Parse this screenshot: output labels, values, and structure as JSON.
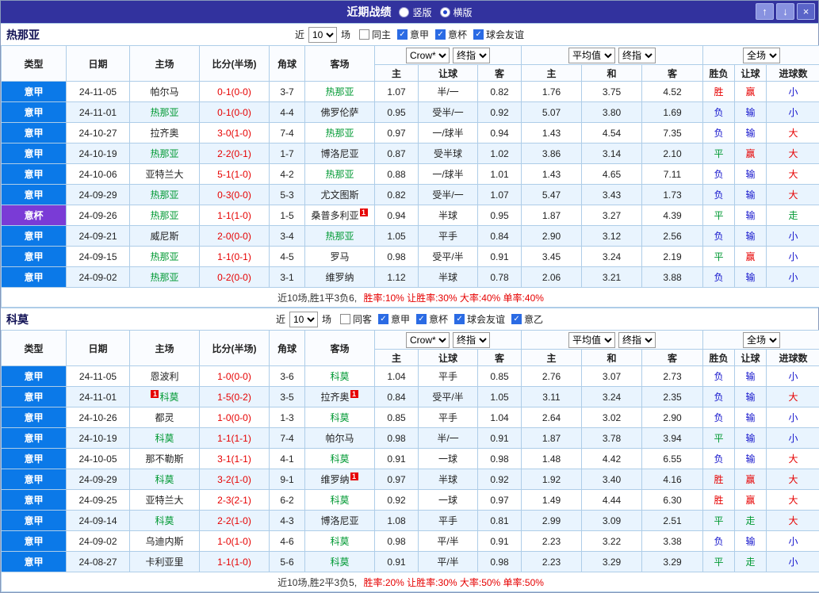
{
  "titlebar": {
    "title": "近期战绩",
    "vertical_label": "竖版",
    "horizontal_label": "横版",
    "selected_layout": "横版",
    "up_glyph": "↑",
    "down_glyph": "↓",
    "close_glyph": "×"
  },
  "colors": {
    "titlebar_bg": "#32329e",
    "league": {
      "意甲": "#0b79e8",
      "意杯": "#7a3bd6"
    },
    "focus_team": "#009933",
    "score": "#e60000",
    "result": {
      "胜": "#e60000",
      "平": "#009933",
      "负": "#1414cc",
      "赢": "#e60000",
      "输": "#1414cc",
      "走": "#009933",
      "大": "#e60000",
      "小": "#1414cc"
    }
  },
  "table_header": {
    "static_cols": [
      "类型",
      "日期",
      "主场",
      "比分(半场)",
      "角球",
      "客场"
    ],
    "groups": [
      {
        "selects": [
          "Crow*",
          "终指"
        ],
        "sub": [
          "主",
          "让球",
          "客"
        ]
      },
      {
        "selects": [
          "平均值",
          "终指"
        ],
        "sub": [
          "主",
          "和",
          "客"
        ]
      },
      {
        "selects": [
          "全场"
        ],
        "sub": [
          "胜负",
          "让球",
          "进球数"
        ]
      }
    ]
  },
  "sections": [
    {
      "team": "热那亚",
      "filter": {
        "near_label": "近",
        "count": "10",
        "games_label": "场",
        "checkboxes": [
          {
            "label": "同主",
            "checked": false
          },
          {
            "label": "意甲",
            "checked": true
          },
          {
            "label": "意杯",
            "checked": true
          },
          {
            "label": "球会友谊",
            "checked": true
          }
        ]
      },
      "rows": [
        {
          "league": "意甲",
          "date": "24-11-05",
          "home": "帕尔马",
          "home_focus": false,
          "score": "0-1(0-0)",
          "corners": "3-7",
          "away": "热那亚",
          "away_focus": true,
          "odds": [
            "1.07",
            "半/一",
            "0.82"
          ],
          "avg": [
            "1.76",
            "3.75",
            "4.52"
          ],
          "results": [
            "胜",
            "赢",
            "小"
          ]
        },
        {
          "league": "意甲",
          "date": "24-11-01",
          "home": "热那亚",
          "home_focus": true,
          "score": "0-1(0-0)",
          "corners": "4-4",
          "away": "佛罗伦萨",
          "away_focus": false,
          "odds": [
            "0.95",
            "受半/一",
            "0.92"
          ],
          "avg": [
            "5.07",
            "3.80",
            "1.69"
          ],
          "results": [
            "负",
            "输",
            "小"
          ]
        },
        {
          "league": "意甲",
          "date": "24-10-27",
          "home": "拉齐奥",
          "home_focus": false,
          "score": "3-0(1-0)",
          "corners": "7-4",
          "away": "热那亚",
          "away_focus": true,
          "odds": [
            "0.97",
            "一/球半",
            "0.94"
          ],
          "avg": [
            "1.43",
            "4.54",
            "7.35"
          ],
          "results": [
            "负",
            "输",
            "大"
          ]
        },
        {
          "league": "意甲",
          "date": "24-10-19",
          "home": "热那亚",
          "home_focus": true,
          "score": "2-2(0-1)",
          "corners": "1-7",
          "away": "博洛尼亚",
          "away_focus": false,
          "odds": [
            "0.87",
            "受半球",
            "1.02"
          ],
          "avg": [
            "3.86",
            "3.14",
            "2.10"
          ],
          "results": [
            "平",
            "赢",
            "大"
          ]
        },
        {
          "league": "意甲",
          "date": "24-10-06",
          "home": "亚特兰大",
          "home_focus": false,
          "score": "5-1(1-0)",
          "corners": "4-2",
          "away": "热那亚",
          "away_focus": true,
          "odds": [
            "0.88",
            "一/球半",
            "1.01"
          ],
          "avg": [
            "1.43",
            "4.65",
            "7.11"
          ],
          "results": [
            "负",
            "输",
            "大"
          ]
        },
        {
          "league": "意甲",
          "date": "24-09-29",
          "home": "热那亚",
          "home_focus": true,
          "score": "0-3(0-0)",
          "corners": "5-3",
          "away": "尤文图斯",
          "away_focus": false,
          "odds": [
            "0.82",
            "受半/一",
            "1.07"
          ],
          "avg": [
            "5.47",
            "3.43",
            "1.73"
          ],
          "results": [
            "负",
            "输",
            "大"
          ]
        },
        {
          "league": "意杯",
          "date": "24-09-26",
          "home": "热那亚",
          "home_focus": true,
          "score": "1-1(1-0)",
          "corners": "1-5",
          "away": "桑普多利亚",
          "away_focus": false,
          "away_card": {
            "pos": "post",
            "text": "1"
          },
          "odds": [
            "0.94",
            "半球",
            "0.95"
          ],
          "avg": [
            "1.87",
            "3.27",
            "4.39"
          ],
          "results": [
            "平",
            "输",
            "走"
          ]
        },
        {
          "league": "意甲",
          "date": "24-09-21",
          "home": "威尼斯",
          "home_focus": false,
          "score": "2-0(0-0)",
          "corners": "3-4",
          "away": "热那亚",
          "away_focus": true,
          "odds": [
            "1.05",
            "平手",
            "0.84"
          ],
          "avg": [
            "2.90",
            "3.12",
            "2.56"
          ],
          "results": [
            "负",
            "输",
            "小"
          ]
        },
        {
          "league": "意甲",
          "date": "24-09-15",
          "home": "热那亚",
          "home_focus": true,
          "score": "1-1(0-1)",
          "corners": "4-5",
          "away": "罗马",
          "away_focus": false,
          "odds": [
            "0.98",
            "受平/半",
            "0.91"
          ],
          "avg": [
            "3.45",
            "3.24",
            "2.19"
          ],
          "results": [
            "平",
            "赢",
            "小"
          ]
        },
        {
          "league": "意甲",
          "date": "24-09-02",
          "home": "热那亚",
          "home_focus": true,
          "score": "0-2(0-0)",
          "corners": "3-1",
          "away": "维罗纳",
          "away_focus": false,
          "odds": [
            "1.12",
            "半球",
            "0.78"
          ],
          "avg": [
            "2.06",
            "3.21",
            "3.88"
          ],
          "results": [
            "负",
            "输",
            "小"
          ]
        }
      ],
      "footer": {
        "prefix": "近10场,胜1平3负6,",
        "stats": "胜率:10% 让胜率:30% 大率:40% 单率:40%"
      }
    },
    {
      "team": "科莫",
      "filter": {
        "near_label": "近",
        "count": "10",
        "games_label": "场",
        "checkboxes": [
          {
            "label": "同客",
            "checked": false
          },
          {
            "label": "意甲",
            "checked": true
          },
          {
            "label": "意杯",
            "checked": true
          },
          {
            "label": "球会友谊",
            "checked": true
          },
          {
            "label": "意乙",
            "checked": true
          }
        ]
      },
      "rows": [
        {
          "league": "意甲",
          "date": "24-11-05",
          "home": "恩波利",
          "home_focus": false,
          "score": "1-0(0-0)",
          "corners": "3-6",
          "away": "科莫",
          "away_focus": true,
          "odds": [
            "1.04",
            "平手",
            "0.85"
          ],
          "avg": [
            "2.76",
            "3.07",
            "2.73"
          ],
          "results": [
            "负",
            "输",
            "小"
          ]
        },
        {
          "league": "意甲",
          "date": "24-11-01",
          "home": "科莫",
          "home_focus": true,
          "home_card": {
            "pos": "pre",
            "text": "1"
          },
          "score": "1-5(0-2)",
          "corners": "3-5",
          "away": "拉齐奥",
          "away_focus": false,
          "away_card": {
            "pos": "post",
            "text": "1"
          },
          "odds": [
            "0.84",
            "受平/半",
            "1.05"
          ],
          "avg": [
            "3.11",
            "3.24",
            "2.35"
          ],
          "results": [
            "负",
            "输",
            "大"
          ]
        },
        {
          "league": "意甲",
          "date": "24-10-26",
          "home": "都灵",
          "home_focus": false,
          "score": "1-0(0-0)",
          "corners": "1-3",
          "away": "科莫",
          "away_focus": true,
          "odds": [
            "0.85",
            "平手",
            "1.04"
          ],
          "avg": [
            "2.64",
            "3.02",
            "2.90"
          ],
          "results": [
            "负",
            "输",
            "小"
          ]
        },
        {
          "league": "意甲",
          "date": "24-10-19",
          "home": "科莫",
          "home_focus": true,
          "score": "1-1(1-1)",
          "corners": "7-4",
          "away": "帕尔马",
          "away_focus": false,
          "odds": [
            "0.98",
            "半/一",
            "0.91"
          ],
          "avg": [
            "1.87",
            "3.78",
            "3.94"
          ],
          "results": [
            "平",
            "输",
            "小"
          ]
        },
        {
          "league": "意甲",
          "date": "24-10-05",
          "home": "那不勒斯",
          "home_focus": false,
          "score": "3-1(1-1)",
          "corners": "4-1",
          "away": "科莫",
          "away_focus": true,
          "odds": [
            "0.91",
            "一球",
            "0.98"
          ],
          "avg": [
            "1.48",
            "4.42",
            "6.55"
          ],
          "results": [
            "负",
            "输",
            "大"
          ]
        },
        {
          "league": "意甲",
          "date": "24-09-29",
          "home": "科莫",
          "home_focus": true,
          "score": "3-2(1-0)",
          "corners": "9-1",
          "away": "维罗纳",
          "away_focus": false,
          "away_card": {
            "pos": "post",
            "text": "1"
          },
          "odds": [
            "0.97",
            "半球",
            "0.92"
          ],
          "avg": [
            "1.92",
            "3.40",
            "4.16"
          ],
          "results": [
            "胜",
            "赢",
            "大"
          ]
        },
        {
          "league": "意甲",
          "date": "24-09-25",
          "home": "亚特兰大",
          "home_focus": false,
          "score": "2-3(2-1)",
          "corners": "6-2",
          "away": "科莫",
          "away_focus": true,
          "odds": [
            "0.92",
            "一球",
            "0.97"
          ],
          "avg": [
            "1.49",
            "4.44",
            "6.30"
          ],
          "results": [
            "胜",
            "赢",
            "大"
          ]
        },
        {
          "league": "意甲",
          "date": "24-09-14",
          "home": "科莫",
          "home_focus": true,
          "score": "2-2(1-0)",
          "corners": "4-3",
          "away": "博洛尼亚",
          "away_focus": false,
          "odds": [
            "1.08",
            "平手",
            "0.81"
          ],
          "avg": [
            "2.99",
            "3.09",
            "2.51"
          ],
          "results": [
            "平",
            "走",
            "大"
          ]
        },
        {
          "league": "意甲",
          "date": "24-09-02",
          "home": "乌迪内斯",
          "home_focus": false,
          "score": "1-0(1-0)",
          "corners": "4-6",
          "away": "科莫",
          "away_focus": true,
          "odds": [
            "0.98",
            "平/半",
            "0.91"
          ],
          "avg": [
            "2.23",
            "3.22",
            "3.38"
          ],
          "results": [
            "负",
            "输",
            "小"
          ]
        },
        {
          "league": "意甲",
          "date": "24-08-27",
          "home": "卡利亚里",
          "home_focus": false,
          "score": "1-1(1-0)",
          "corners": "5-6",
          "away": "科莫",
          "away_focus": true,
          "odds": [
            "0.91",
            "平/半",
            "0.98"
          ],
          "avg": [
            "2.23",
            "3.29",
            "3.29"
          ],
          "results": [
            "平",
            "走",
            "小"
          ]
        }
      ],
      "footer": {
        "prefix": "近10场,胜2平3负5,",
        "stats": "胜率:20% 让胜率:30% 大率:50% 单率:50%"
      }
    }
  ]
}
